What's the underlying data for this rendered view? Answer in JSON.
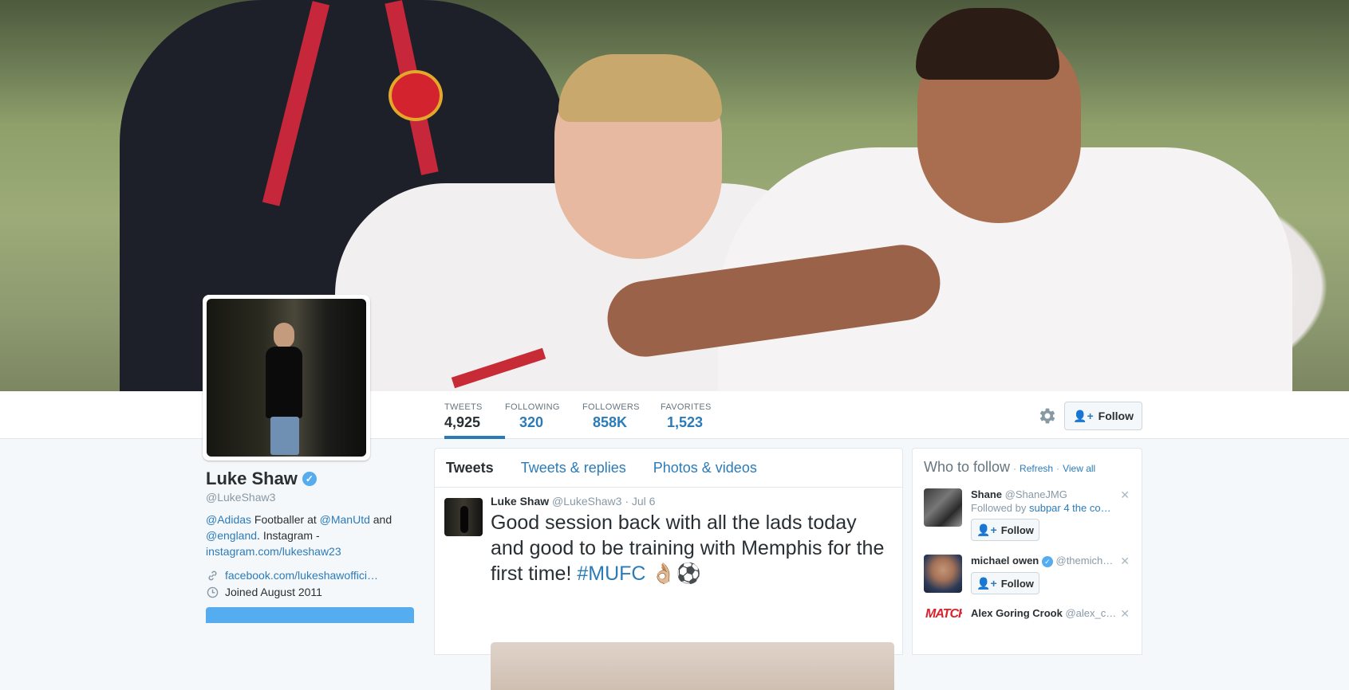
{
  "profile": {
    "name": "Luke Shaw",
    "handle": "@LukeShaw3",
    "bio": {
      "mention1": "@Adidas",
      "text1": " Footballer at ",
      "mention2": "@ManUtd",
      "text2": " and ",
      "mention3": "@england",
      "text3": ". Instagram - ",
      "link": "instagram.com/lukeshaw23"
    },
    "website": "facebook.com/lukeshawoffici…",
    "joined": "Joined August 2011"
  },
  "stats": [
    {
      "label": "TWEETS",
      "value": "4,925"
    },
    {
      "label": "FOLLOWING",
      "value": "320"
    },
    {
      "label": "FOLLOWERS",
      "value": "858K"
    },
    {
      "label": "FAVORITES",
      "value": "1,523"
    }
  ],
  "follow_button": "Follow",
  "tabs": [
    "Tweets",
    "Tweets & replies",
    "Photos & videos"
  ],
  "tweet": {
    "name": "Luke Shaw",
    "handle": "@LukeShaw3",
    "date": "· Jul 6",
    "text": "Good session back with all the lads today and good to be training with Memphis for the first time! ",
    "hashtag": "#MUFC",
    "emoji": " 👌🏼⚽"
  },
  "who_to_follow": {
    "title": "Who to follow",
    "sep": "·",
    "refresh": "Refresh",
    "view_all": "View all",
    "suggestions": [
      {
        "name": "Shane",
        "handle": "@ShaneJMG",
        "followed_by_prefix": "Followed by ",
        "followed_by": "subpar 4 the co…",
        "button": "Follow"
      },
      {
        "name": "michael owen",
        "handle": "@themich…",
        "button": "Follow"
      },
      {
        "name": "Alex Goring Crook",
        "handle": "@alex_c…",
        "avatar_text": "MATCH"
      }
    ]
  },
  "colors": {
    "accent": "#2b7bb9",
    "verified": "#55acee",
    "text": "#292f33",
    "muted": "#8899a6"
  }
}
